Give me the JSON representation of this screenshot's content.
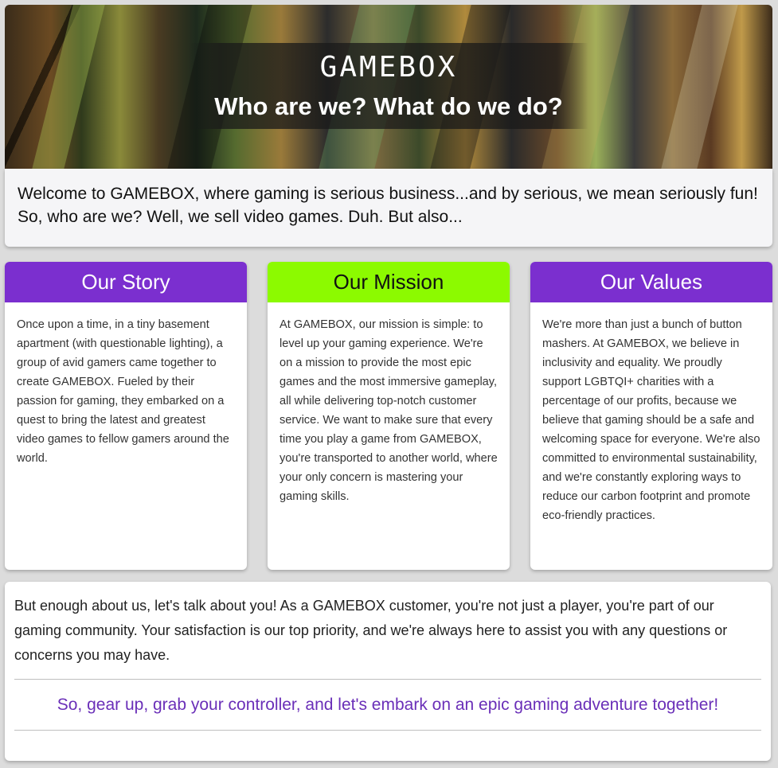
{
  "hero": {
    "brand": "GAMEBOX",
    "subtitle": "Who are we? What do we do?"
  },
  "intro": {
    "text": "Welcome to GAMEBOX, where gaming is serious business...and by serious, we mean seriously fun! So, who are we? Well, we sell video games. Duh. But also..."
  },
  "cards": [
    {
      "title": "Our Story",
      "color": "#7b2fcf",
      "text": "Once upon a time, in a tiny basement apartment (with questionable lighting), a group of avid gamers came together to create GAMEBOX. Fueled by their passion for gaming, they embarked on a quest to bring the latest and greatest video games to fellow gamers around the world."
    },
    {
      "title": "Our Mission",
      "color": "#8cfa00",
      "text": "At GAMEBOX, our mission is simple: to level up your gaming experience. We're on a mission to provide the most epic games and the most immersive gameplay, all while delivering top-notch customer service. We want to make sure that every time you play a game from GAMEBOX, you're transported to another world, where your only concern is mastering your gaming skills."
    },
    {
      "title": "Our Values",
      "color": "#7b2fcf",
      "text": "We're more than just a bunch of button mashers. At GAMEBOX, we believe in inclusivity and equality. We proudly support LGBTQI+ charities with a percentage of our profits, because we believe that gaming should be a safe and welcoming space for everyone. We're also committed to environmental sustainability, and we're constantly exploring ways to reduce our carbon footprint and promote eco-friendly practices."
    }
  ],
  "bottom": {
    "text": "But enough about us, let's talk about you! As a GAMEBOX customer, you're not just a player, you're part of our gaming community. Your satisfaction is our top priority, and we're always here to assist you with any questions or concerns you may have.",
    "cta": "So, gear up, grab your controller, and let's embark on an epic gaming adventure together!"
  }
}
